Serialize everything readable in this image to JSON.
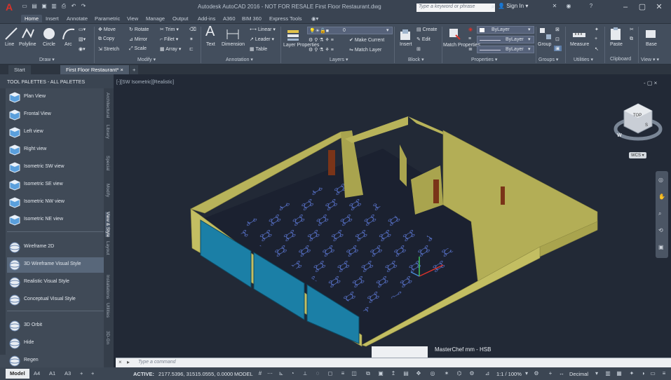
{
  "app": {
    "title": "Autodesk AutoCAD 2016 - NOT FOR RESALE    First Floor Restaurant.dwg",
    "search_placeholder": "Type a keyword or phrase",
    "sign_in": "Sign In"
  },
  "ribbon_tabs": [
    "Home",
    "Insert",
    "Annotate",
    "Parametric",
    "View",
    "Manage",
    "Output",
    "Add-ins",
    "A360",
    "BIM 360",
    "Express Tools"
  ],
  "ribbon": {
    "draw": {
      "line": "Line",
      "polyline": "Polyline",
      "circle": "Circle",
      "arc": "Arc",
      "label": "Draw"
    },
    "modify": {
      "move": "Move",
      "rotate": "Rotate",
      "trim": "Trim",
      "copy": "Copy",
      "mirror": "Mirror",
      "fillet": "Fillet",
      "stretch": "Stretch",
      "scale": "Scale",
      "array": "Array",
      "label": "Modify"
    },
    "annotation": {
      "text": "Text",
      "dimension": "Dimension",
      "linear": "Linear",
      "leader": "Leader",
      "table": "Table",
      "label": "Annotation"
    },
    "layers": {
      "layer_properties": "Layer Properties",
      "current_layer": "0",
      "make_current": "Make Current",
      "match_layer": "Match Layer",
      "label": "Layers"
    },
    "block": {
      "insert": "Insert",
      "create": "Create",
      "edit": "Edit",
      "label": "Block"
    },
    "properties": {
      "match": "Match Properties",
      "bylayer1": "ByLayer",
      "bylayer2": "ByLayer",
      "bylayer3": "ByLayer",
      "label": "Properties"
    },
    "groups": {
      "group": "Group",
      "label": "Groups"
    },
    "utilities": {
      "measure": "Measure",
      "label": "Utilities"
    },
    "clipboard": {
      "paste": "Paste",
      "label": "Clipboard"
    },
    "view": {
      "base": "Base",
      "label": "View"
    }
  },
  "doc_tabs": [
    "Start",
    "First Floor Restaurant*"
  ],
  "palette": {
    "title": "TOOL PALETTES - ALL PALETTES",
    "items": [
      "Plan View",
      "Frontal View",
      "Left view",
      "Right view",
      "Isometric SW view",
      "Isometric SE view",
      "Isometric NW view",
      "Isometric NE view",
      "Wireframe 2D",
      "3D Wireframe Visual Style",
      "Realistic Visual Style",
      "Conceptual Visual Style",
      "3D Orbit",
      "Hide",
      "Regen"
    ],
    "vertical_tabs": [
      "Architectural",
      "Library",
      "Special",
      "Modify",
      "View & Style",
      "Layout",
      "Installations",
      "Utilities",
      "3D-Gn"
    ]
  },
  "viewport": {
    "label": "[-][SW Isometric][Realistic]",
    "controls": "-  ▢  ×",
    "wcs": "WCS",
    "viewcube": {
      "top": "TOP",
      "front": "S",
      "compass_w": "W"
    },
    "overlay_text": "MasterChef mm - HSB"
  },
  "command": {
    "placeholder": "Type a command"
  },
  "status": {
    "layout_tabs": [
      "Model",
      "A4",
      "A1",
      "A3"
    ],
    "active": "ACTIVE:",
    "coords": "2177.5396, 31515.0555, 0.0000",
    "model": "MODEL",
    "scale": "1:1 / 100%",
    "units": "Decimal"
  },
  "colors": {
    "wall": "#b8b35a",
    "wall_dark": "#8c8840",
    "glass": "#1b7fa6",
    "floor": "#1d2230",
    "bg": "#222936",
    "accent": "#d9322a"
  }
}
